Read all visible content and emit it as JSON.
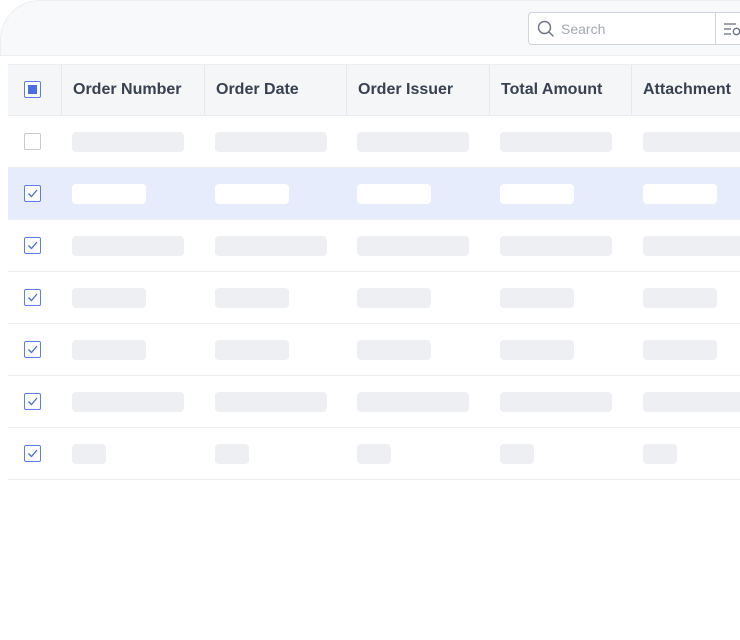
{
  "search": {
    "placeholder": "Search",
    "value": ""
  },
  "icons": {
    "search": "search-icon",
    "filter": "filter-icon",
    "checkbox_checked": "check-icon"
  },
  "colors": {
    "accent": "#4b6fe3",
    "selected_row": "#e6ecfb",
    "header_bg": "#f5f6f8",
    "skeleton": "#eeeff3"
  },
  "table": {
    "header_checkbox_state": "indeterminate",
    "columns": [
      {
        "key": "order_number",
        "label": "Order Number"
      },
      {
        "key": "order_date",
        "label": "Order Date"
      },
      {
        "key": "order_issuer",
        "label": "Order Issuer"
      },
      {
        "key": "total_amount",
        "label": "Total Amount"
      },
      {
        "key": "attachment",
        "label": "Attachment"
      }
    ],
    "rows": [
      {
        "checked": false,
        "selected": false,
        "loading": true
      },
      {
        "checked": true,
        "selected": true,
        "loading": true
      },
      {
        "checked": true,
        "selected": false,
        "loading": true
      },
      {
        "checked": true,
        "selected": false,
        "loading": true
      },
      {
        "checked": true,
        "selected": false,
        "loading": true
      },
      {
        "checked": true,
        "selected": false,
        "loading": true
      },
      {
        "checked": true,
        "selected": false,
        "loading": true
      }
    ]
  }
}
